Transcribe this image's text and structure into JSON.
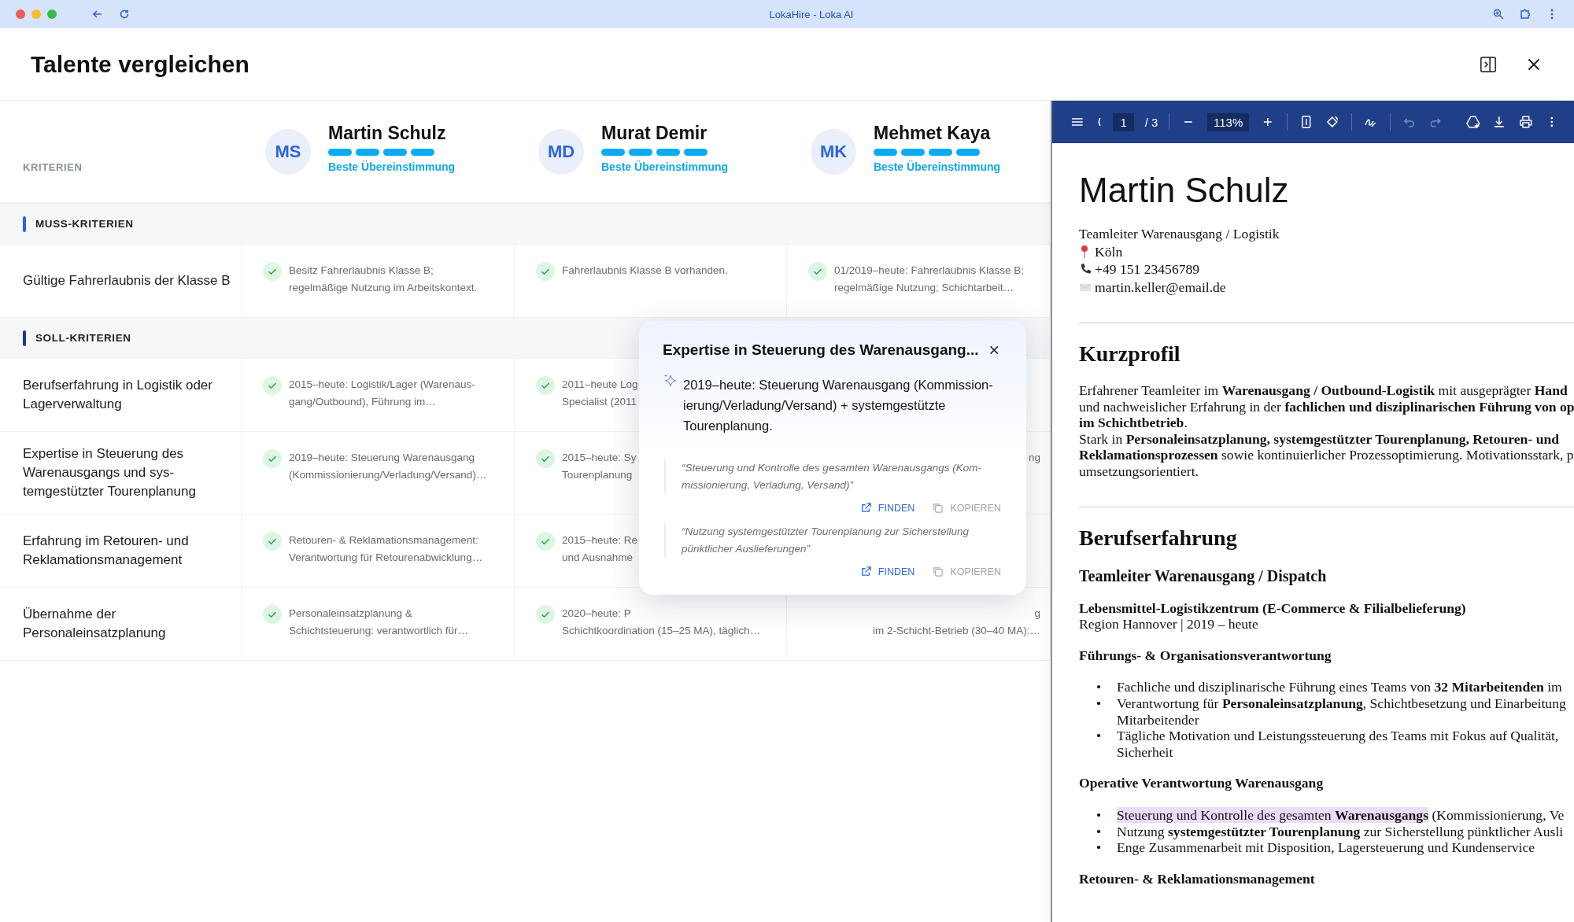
{
  "browser": {
    "title": "LokaHire - Loka AI"
  },
  "header": {
    "title": "Talente vergleichen"
  },
  "comparison": {
    "criteria_heading": "KRITERIEN",
    "candidates": [
      {
        "initials": "MS",
        "name": "Martin Schulz",
        "stars": 4,
        "label": "Beste Übereinstimmung"
      },
      {
        "initials": "MD",
        "name": "Murat Demir",
        "stars": 4,
        "label": "Beste Übereinstimmung"
      },
      {
        "initials": "MK",
        "name": "Mehmet Kaya",
        "stars": 4,
        "label": "Beste Übereinstimmung"
      }
    ],
    "sections": [
      {
        "title": "MUSS-KRITERIEN",
        "color": "#2563eb",
        "rows": [
          {
            "criterion": [
              "Gültige Fahrerlaubnis der Klasse B"
            ],
            "cells": [
              {
                "covered": false,
                "lines": [
                  "Besitz Fahrerlaubnis Klasse B;",
                  "regelmäßige Nutzung im Arbeitskontext."
                ]
              },
              {
                "covered": false,
                "lines": [
                  "Fahrerlaubnis Klasse B vorhanden."
                ]
              },
              {
                "covered": false,
                "lines": [
                  "01/2019–heute: Fahrerlaubnis Klasse B;",
                  "regelmäßige Nutzung; Schichtarbeit…"
                ]
              }
            ]
          }
        ]
      },
      {
        "title": "SOLL-KRITERIEN",
        "color": "#1e3a8a",
        "rows": [
          {
            "criterion": [
              "Berufserfahrung in Logistik oder",
              "Lagerverwaltung"
            ],
            "cells": [
              {
                "covered": false,
                "lines": [
                  "2015–heute: Logistik/Lager (Warenaus-",
                  "gang/Outbound), Führung im…"
                ]
              },
              {
                "covered": false,
                "lines": [
                  "2011–heute Log",
                  "Specialist (2011"
                ]
              }
            ]
          },
          {
            "criterion": [
              "Expertise in Steuerung des",
              "Warenausgangs und sys-",
              "temgestützter Tourenplanung"
            ],
            "cells": [
              {
                "covered": false,
                "lines": [
                  "2019–heute: Steuerung Warenausgang",
                  "(Kommissionierung/Verladung/Versand)…"
                ]
              },
              {
                "covered": false,
                "lines": [
                  "2015–heute: Sy",
                  "Tourenplanung"
                ]
              },
              {
                "covered": true,
                "lines": [
                  "ng"
                ]
              }
            ]
          },
          {
            "criterion": [
              "Erfahrung im Retouren- und",
              "Reklamationsmanagement"
            ],
            "cells": [
              {
                "covered": false,
                "lines": [
                  "Retouren- & Reklamationsmanagement:",
                  "Verantwortung für Retourenabwicklung…"
                ]
              },
              {
                "covered": false,
                "lines": [
                  "2015–heute: Re",
                  "und Ausnahme"
                ]
              }
            ]
          },
          {
            "criterion": [
              "Übernahme der",
              "Personaleinsatzplanung"
            ],
            "cells": [
              {
                "covered": false,
                "lines": [
                  "Personaleinsatzplanung &",
                  "Schichtsteuerung: verantwortlich für…"
                ]
              },
              {
                "covered": false,
                "lines": [
                  "2020–heute: P",
                  "Schichtkoordination (15–25 MA), täglich…"
                ]
              },
              {
                "covered": true,
                "lines": [
                  "g",
                  "im 2-Schicht-Betrieb (30–40 MA):…"
                ]
              }
            ]
          }
        ]
      }
    ]
  },
  "popover": {
    "title": "Expertise in Steuerung des Warenausgang...",
    "summary": [
      "2019–heute: Steuerung Warenausgang (Kommission-",
      "ierung/Verladung/Versand) + systemgestützte",
      "Tourenplanung."
    ],
    "quotes": [
      {
        "lines": [
          "“Steuerung und Kontrolle des gesamten Warenausgangs (Kom-",
          "missionierung, Verladung, Versand)”"
        ],
        "find": "FINDEN",
        "copy": "KOPIEREN"
      },
      {
        "lines": [
          "“Nutzung systemgestützter Tourenplanung zur Sicherstellung",
          "pünktlicher Auslieferungen”"
        ],
        "find": "FINDEN",
        "copy": "KOPIEREN"
      }
    ]
  },
  "pdf_viewer": {
    "toolbar": {
      "page": "1",
      "page_total": "/ 3",
      "zoom": "113%",
      "undo_disabled": true,
      "redo_disabled": true
    },
    "document": {
      "name": "Martin Schulz",
      "contact": [
        {
          "kind": "plain",
          "text": "Teamleiter Warenausgang / Logistik"
        },
        {
          "kind": "pin",
          "text": "Köln"
        },
        {
          "kind": "phone",
          "text": "+49 151 23456789"
        },
        {
          "kind": "mail",
          "text": "martin.keller@email.de"
        }
      ],
      "sections": [
        {
          "heading": "Kurzprofil",
          "blocks": [
            {
              "kind": "paragraph",
              "lines": [
                "Erfahrener Teamleiter im **Warenausgang / Outbound-Logistik** mit ausgeprägter **Hand**",
                "und nachweislicher Erfahrung in der **fachlichen und disziplinarischen Führung von op**",
                "**im Schichtbetrieb**.",
                "Stark in **Personaleinsatzplanung, systemgestützter Tourenplanung, Retouren- und**",
                "**Reklamationsprozessen** sowie kontinuierlicher Prozessoptimierung. Motivationsstark, p",
                "umsetzungsorientiert."
              ]
            }
          ]
        },
        {
          "heading": "Berufserfahrung",
          "blocks": [
            {
              "kind": "job",
              "lines": [
                "Teamleiter Warenausgang / Dispatch"
              ]
            },
            {
              "kind": "company",
              "lines": [
                "Lebensmittel-Logistikzentrum (E-Commerce & Filialbelieferung)"
              ]
            },
            {
              "kind": "meta",
              "lines": [
                "Region Hannover | 2019 – heute"
              ]
            },
            {
              "kind": "group",
              "lines": [
                "Führungs- & Organisationsverantwortung"
              ]
            },
            {
              "kind": "bullets",
              "marker": "•",
              "items": [
                {
                  "lines": [
                    "Fachliche und disziplinarische Führung eines Teams von **32 Mitarbeitenden** im"
                  ]
                },
                {
                  "lines": [
                    "Verantwortung für **Personaleinsatzplanung**, Schichtbesetzung und Einarbeitung",
                    "Mitarbeitender"
                  ]
                },
                {
                  "lines": [
                    "Tägliche Motivation und Leistungssteuerung des Teams mit Fokus auf Qualität, ",
                    "Sicherheit"
                  ]
                }
              ]
            },
            {
              "kind": "group",
              "lines": [
                "Operative Verantwortung Warenausgang"
              ]
            },
            {
              "kind": "bullets",
              "marker": "•",
              "items": [
                {
                  "marked": "Steuerung und Kontrolle des gesamten **Warenausgangs**",
                  "lines": [
                    " (Kommissionierung, Ve"
                  ]
                },
                {
                  "lines": [
                    "Nutzung **systemgestützter Tourenplanung** zur Sicherstellung pünktlicher Ausli"
                  ]
                },
                {
                  "lines": [
                    "Enge Zusammenarbeit mit Disposition, Lagersteuerung und Kundenservice"
                  ]
                }
              ]
            },
            {
              "kind": "group",
              "lines": [
                "Retouren- & Reklamationsmanagement"
              ]
            }
          ]
        }
      ]
    }
  }
}
